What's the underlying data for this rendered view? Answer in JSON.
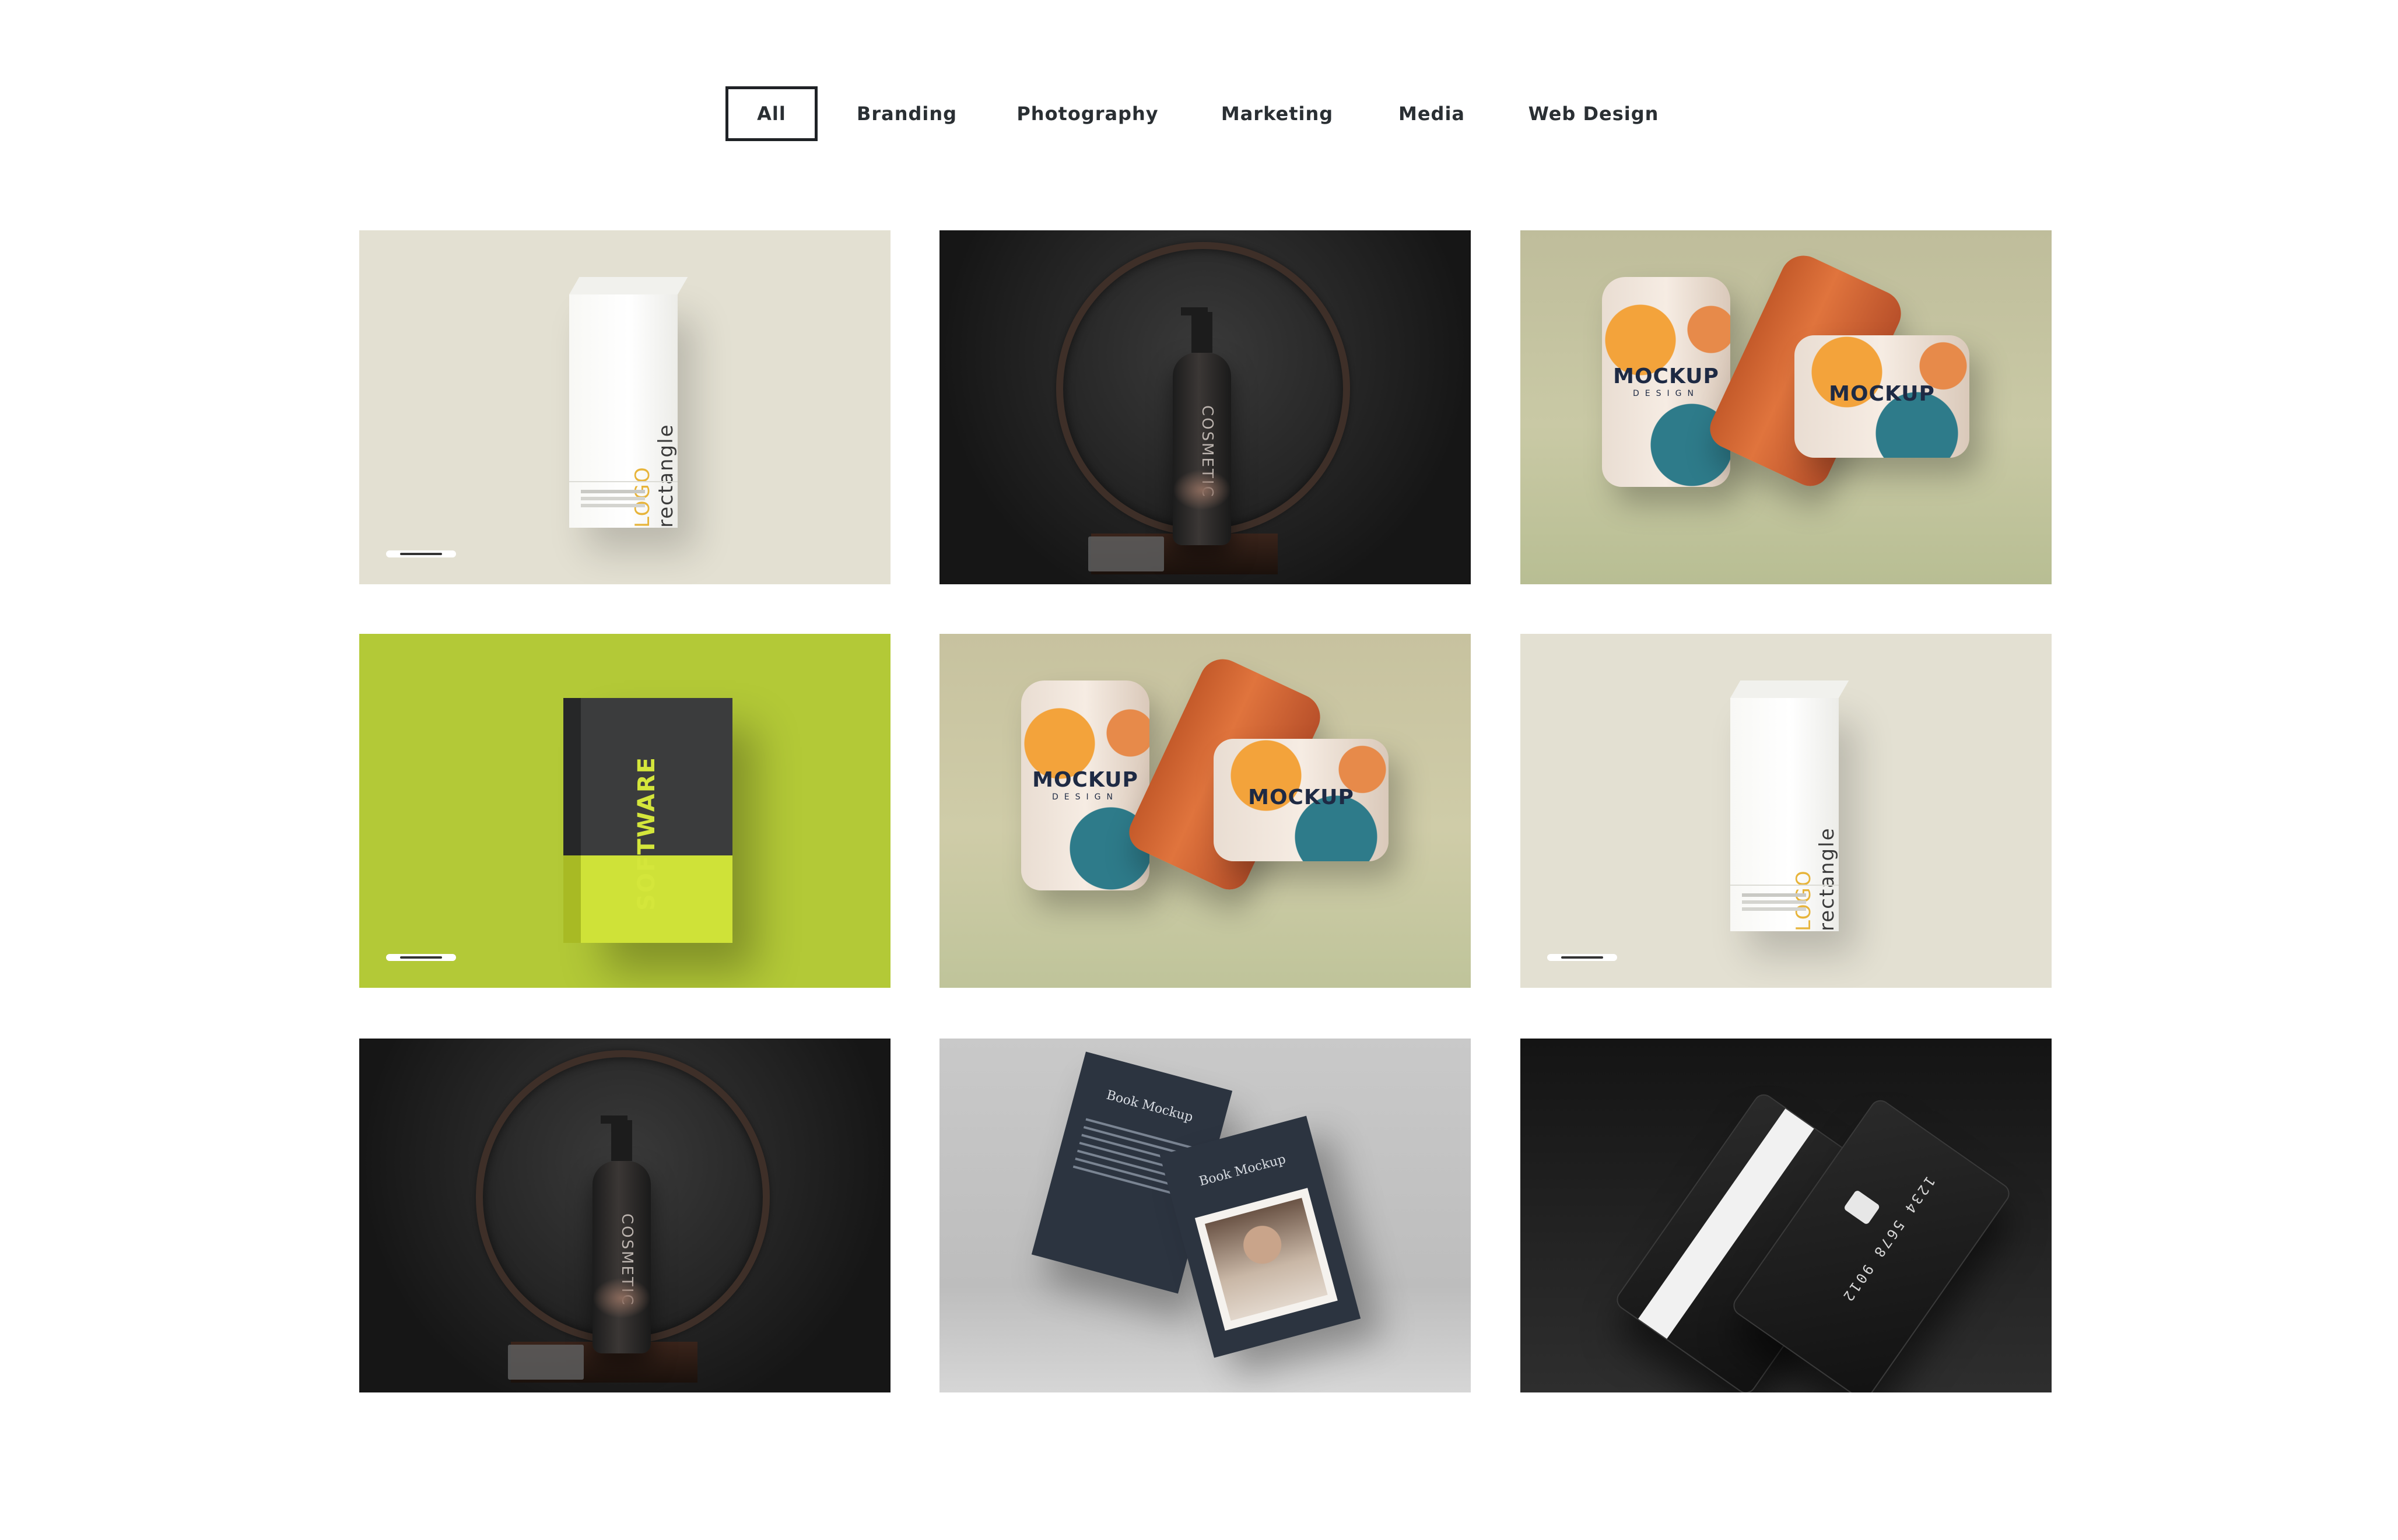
{
  "filters": {
    "tabs": [
      {
        "label": "All",
        "active": true
      },
      {
        "label": "Branding",
        "active": false
      },
      {
        "label": "Photography",
        "active": false
      },
      {
        "label": "Marketing",
        "active": false
      },
      {
        "label": "Media",
        "active": false
      },
      {
        "label": "Web Design",
        "active": false
      }
    ]
  },
  "gallery": {
    "items": [
      {
        "bg": "#e3e0d2"
      },
      {
        "bg": "#2a2a2a"
      },
      {
        "bg": "#c4c4a2"
      },
      {
        "bg": "#b3c937"
      },
      {
        "bg": "#c5c39e"
      },
      {
        "bg": "#e3e0d2"
      },
      {
        "bg": "#2a2a2a"
      },
      {
        "bg": "#c4c4c4"
      },
      {
        "bg": "#1e1e1e"
      }
    ],
    "mockup_text": {
      "box_logo": "LOGO",
      "box_logo_sub": "rectangle",
      "bottle_label": "COSMETIC",
      "can_title": "MOCKUP",
      "can_sub": "DESIGN",
      "software_title": "SOFTWARE",
      "book_title": "Book Mockup",
      "card_number": "1234 5678 9012"
    }
  }
}
